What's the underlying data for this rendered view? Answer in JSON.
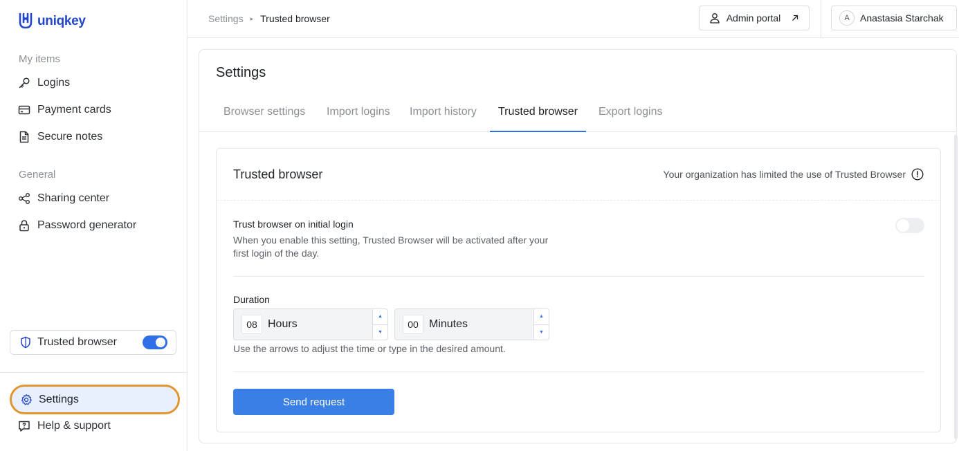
{
  "brand": {
    "name": "uniqkey",
    "color": "#2447c8"
  },
  "sidebar": {
    "sections": [
      {
        "label": "My items",
        "items": [
          {
            "label": "Logins",
            "icon": "key-icon"
          },
          {
            "label": "Payment cards",
            "icon": "credit-card-icon"
          },
          {
            "label": "Secure notes",
            "icon": "note-icon"
          }
        ]
      },
      {
        "label": "General",
        "items": [
          {
            "label": "Sharing center",
            "icon": "share-icon"
          },
          {
            "label": "Password generator",
            "icon": "lock-icon"
          }
        ]
      }
    ],
    "trusted_browser": {
      "label": "Trusted browser",
      "enabled": true
    },
    "bottom": [
      {
        "label": "Settings",
        "icon": "gear-icon",
        "active": true
      },
      {
        "label": "Help & support",
        "icon": "help-icon"
      }
    ]
  },
  "topbar": {
    "breadcrumb": [
      "Settings",
      "Trusted browser"
    ],
    "admin_portal": "Admin portal",
    "user": {
      "initial": "A",
      "name": "Anastasia Starchak"
    }
  },
  "main": {
    "title": "Settings",
    "tabs": [
      {
        "label": "Browser settings",
        "active": false
      },
      {
        "label": "Import logins",
        "active": false
      },
      {
        "label": "Import history",
        "active": false
      },
      {
        "label": "Trusted browser",
        "active": true
      },
      {
        "label": "Export logins",
        "active": false
      }
    ],
    "panel": {
      "title": "Trusted browser",
      "notice": "Your organization has limited the use of Trusted Browser",
      "option": {
        "title": "Trust browser on initial login",
        "description": "When you enable this setting, Trusted Browser will be activated after your first login of the day.",
        "enabled": false
      },
      "duration": {
        "label": "Duration",
        "hours_value": "08",
        "hours_unit": "Hours",
        "minutes_value": "00",
        "minutes_unit": "Minutes",
        "hint": "Use the arrows to adjust the time or type in the desired amount."
      },
      "submit": "Send request"
    }
  },
  "colors": {
    "accent": "#2f6fe8",
    "button": "#3a7fe5",
    "highlight": "#e0952f"
  }
}
